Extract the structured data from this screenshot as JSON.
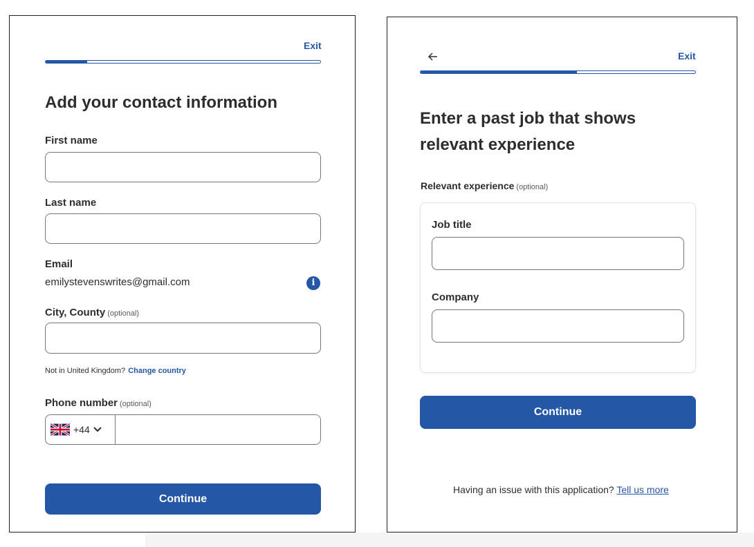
{
  "left_form": {
    "exit_label": "Exit",
    "progress": 0.15,
    "title": "Add your contact information",
    "first_name": {
      "label": "First name",
      "value": ""
    },
    "last_name": {
      "label": "Last name",
      "value": ""
    },
    "email": {
      "label": "Email",
      "value": "emilystevenswrites@gmail.com",
      "info_icon": "info-icon"
    },
    "city": {
      "label": "City, County",
      "optional_tag": "(optional)",
      "value": ""
    },
    "country_note": {
      "text": "Not in United Kingdom?",
      "link": "Change country"
    },
    "phone": {
      "label": "Phone number",
      "optional_tag": "(optional)",
      "flag_icon": "uk-flag-icon",
      "dial_code": "+44",
      "value": ""
    },
    "continue_label": "Continue"
  },
  "right_form": {
    "back_icon": "back-arrow-icon",
    "exit_label": "Exit",
    "progress": 0.57,
    "title": "Enter a past job that shows relevant experience",
    "section_label": "Relevant experience",
    "section_optional_tag": "(optional)",
    "job_title": {
      "label": "Job title",
      "value": ""
    },
    "company": {
      "label": "Company",
      "value": ""
    },
    "continue_label": "Continue",
    "footer_text": "Having an issue with this application?",
    "footer_link": "Tell us more"
  },
  "colors": {
    "primary": "#2557a7",
    "text": "#2d2d2d",
    "border": "#767676"
  }
}
